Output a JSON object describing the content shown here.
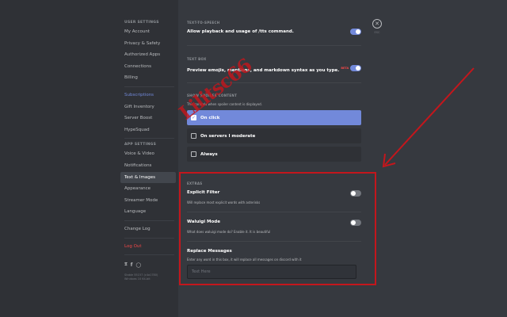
{
  "sidebar": {
    "user_settings_header": "USER SETTINGS",
    "user_items": [
      "My Account",
      "Privacy & Safety",
      "Authorized Apps",
      "Connections",
      "Billing"
    ],
    "nitro_items": [
      "Subscriptions",
      "Gift Inventory",
      "Server Boost",
      "HypeSquad"
    ],
    "app_settings_header": "APP SETTINGS",
    "app_items": [
      "Voice & Video",
      "Notifications",
      "Text & Images",
      "Appearance",
      "Streamer Mode",
      "Language"
    ],
    "change_log": "Change Log",
    "log_out": "Log Out",
    "social_icons": [
      "twitter-icon",
      "facebook-icon",
      "instagram-icon"
    ],
    "meta_line1": "Stable 55157 (c4a1780)",
    "meta_line2": "Windows 10 64-bit"
  },
  "close": {
    "label": "ESC"
  },
  "text_to_speech": {
    "header": "TEXT-TO-SPEECH",
    "label": "Allow playback and usage of /tts command.",
    "enabled": true
  },
  "text_box": {
    "header": "TEXT BOX",
    "label": "Preview emojis, mentions, and markdown syntax as you type.",
    "badge": "BETA",
    "enabled": true
  },
  "spoiler": {
    "header": "SHOW SPOILER CONTENT",
    "description": "This controls when spoiler content is displayed.",
    "options": [
      "On click",
      "On servers I moderate",
      "Always"
    ],
    "selected": "On click"
  },
  "extras": {
    "header": "EXTRAS",
    "explicit_filter": {
      "label": "Explicit Filter",
      "description": "Will replace most explicit words with asterisks",
      "enabled": false
    },
    "waluigi_mode": {
      "label": "Waluigi Mode",
      "description": "What does waluigi mode do? Enable it. It is beautiful",
      "enabled": false
    },
    "replace_messages": {
      "label": "Replace Messages",
      "description": "Enter any word in this box, it will replace all messages on discord with it",
      "placeholder": "Text Here"
    }
  },
  "watermark": "Lilitsc66",
  "colors": {
    "accent": "#7289da",
    "annotation_red": "#c4161c",
    "background": "#36393f",
    "sidebar": "#2f3136"
  }
}
